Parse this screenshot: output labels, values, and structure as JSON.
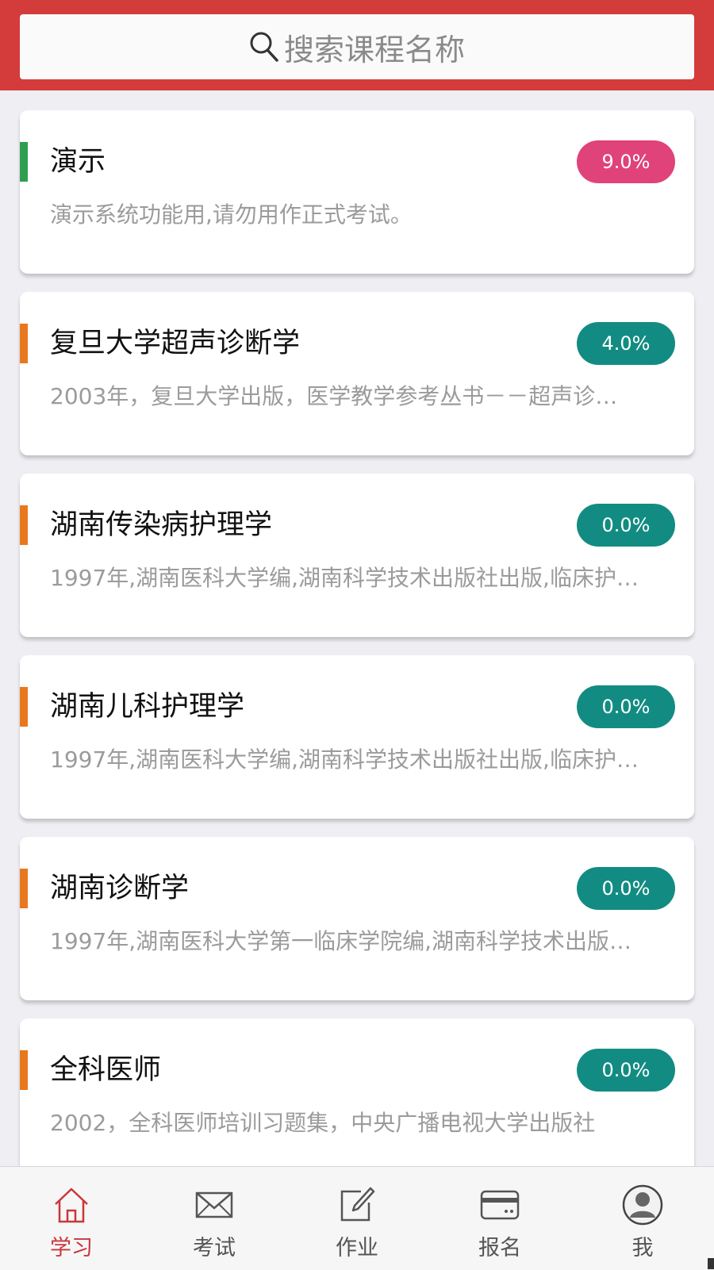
{
  "search": {
    "placeholder": "搜索课程名称"
  },
  "courses": [
    {
      "title": "演示",
      "progress": "9.0%",
      "desc": "演示系统功能用,请勿用作正式考试。",
      "bar_color": "#2e9e51",
      "badge_color": "#e0427a"
    },
    {
      "title": "复旦大学超声诊断学",
      "progress": "4.0%",
      "desc": "2003年，复旦大学出版，医学教学参考丛书－－超声诊…",
      "bar_color": "#e8781e",
      "badge_color": "#128c82"
    },
    {
      "title": "湖南传染病护理学",
      "progress": "0.0%",
      "desc": "1997年,湖南医科大学编,湖南科学技术出版社出版,临床护…",
      "bar_color": "#e8781e",
      "badge_color": "#128c82"
    },
    {
      "title": "湖南儿科护理学",
      "progress": "0.0%",
      "desc": "1997年,湖南医科大学编,湖南科学技术出版社出版,临床护…",
      "bar_color": "#e8781e",
      "badge_color": "#128c82"
    },
    {
      "title": "湖南诊断学",
      "progress": "0.0%",
      "desc": "1997年,湖南医科大学第一临床学院编,湖南科学技术出版…",
      "bar_color": "#e8781e",
      "badge_color": "#128c82"
    },
    {
      "title": "全科医师",
      "progress": "0.0%",
      "desc": "2002，全科医师培训习题集，中央广播电视大学出版社",
      "bar_color": "#e8781e",
      "badge_color": "#128c82"
    }
  ],
  "tabs": [
    {
      "label": "学习",
      "icon": "home-icon",
      "active": true
    },
    {
      "label": "考试",
      "icon": "mail-icon",
      "active": false
    },
    {
      "label": "作业",
      "icon": "edit-icon",
      "active": false
    },
    {
      "label": "报名",
      "icon": "card-icon",
      "active": false
    },
    {
      "label": "我",
      "icon": "user-icon",
      "active": false
    }
  ],
  "colors": {
    "header": "#d43c3c",
    "active_tab": "#c8373b"
  }
}
